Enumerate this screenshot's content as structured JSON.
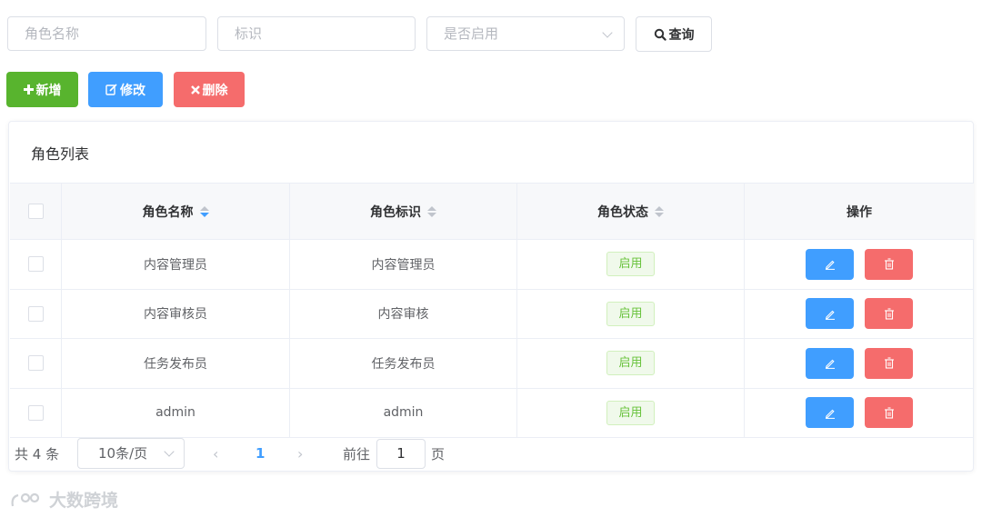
{
  "filters": {
    "role_name_placeholder": "角色名称",
    "identifier_placeholder": "标识",
    "status_placeholder": "是否启用",
    "query_label": "查询"
  },
  "actions": {
    "add_label": "新增",
    "edit_label": "修改",
    "delete_label": "删除"
  },
  "table": {
    "title": "角色列表",
    "headers": [
      "角色名称",
      "角色标识",
      "角色状态",
      "操作"
    ],
    "rows": [
      {
        "name": "内容管理员",
        "key": "内容管理员",
        "status": "启用"
      },
      {
        "name": "内容审核员",
        "key": "内容审核",
        "status": "启用"
      },
      {
        "name": "任务发布员",
        "key": "任务发布员",
        "status": "启用"
      },
      {
        "name": "admin",
        "key": "admin",
        "status": "启用"
      }
    ]
  },
  "pagination": {
    "total_text": "共 4 条",
    "page_size": "10条/页",
    "current_page": "1",
    "goto_label": "前往",
    "goto_value": "1",
    "page_suffix": "页"
  },
  "watermark": "大数跨境",
  "colors": {
    "primary": "#409eff",
    "success": "#67c23a",
    "add_button": "#58b42e",
    "danger": "#f56c6c"
  }
}
